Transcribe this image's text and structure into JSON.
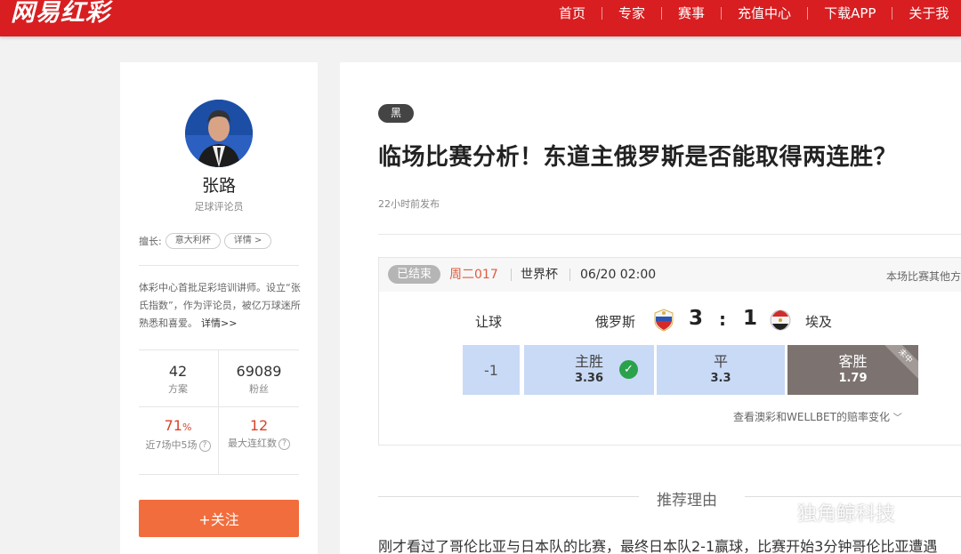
{
  "header": {
    "logo": "网易红彩",
    "nav": [
      "首页",
      "专家",
      "赛事",
      "充值中心",
      "下载APP",
      "关于我"
    ]
  },
  "profile": {
    "name": "张路",
    "role": "足球评论员",
    "specialty_label": "擅长:",
    "specialty_tag": "意大利杯",
    "detail_tag": "详情 >",
    "bio": "体彩中心首批足彩培训讲师。设立“张氏指数”，作为评论员，被亿万球迷所熟悉和喜爱。",
    "bio_more": "详情>>",
    "stats": {
      "plans": {
        "value": "42",
        "label": "方案"
      },
      "fans": {
        "value": "69089",
        "label": "粉丝"
      },
      "hit_rate": {
        "value": "71",
        "unit": "%",
        "label": "近7场中5场"
      },
      "streak": {
        "value": "12",
        "label": "最大连红数"
      }
    },
    "follow_label": "+关注"
  },
  "article": {
    "badge": "黑",
    "title": "临场比赛分析！东道主俄罗斯是否能取得两连胜？",
    "published": "22小时前发布",
    "match": {
      "status": "已结束",
      "match_no": "周二017",
      "league": "世界杯",
      "datetime": "06/20 02:00",
      "other_link": "本场比赛其他方",
      "handicap_label": "让球",
      "home_team": "俄罗斯",
      "away_team": "埃及",
      "home_score": "3",
      "score_sep": ":",
      "away_score": "1",
      "handicap_value": "-1",
      "odds": [
        {
          "name": "主胜",
          "value": "3.36"
        },
        {
          "name": "平",
          "value": "3.3"
        },
        {
          "name": "客胜",
          "value": "1.79"
        }
      ],
      "ribbon": "未中",
      "odds_link": "查看澳彩和WELLBET的赔率变化"
    },
    "reason_title": "推荐理由",
    "body": "刚才看过了哥伦比亚与日本队的比赛，最终日本队2-1赢球，比赛开始3分钟哥伦比亚遭遇"
  },
  "watermark": "独角鲸科技",
  "colors": {
    "brand_red": "#d81e21",
    "follow_orange": "#f26d3d",
    "odds_blue": "#c9daf6",
    "odds_gray": "#7c7370",
    "check_green": "#2aa24b",
    "stat_red": "#d9432b"
  }
}
